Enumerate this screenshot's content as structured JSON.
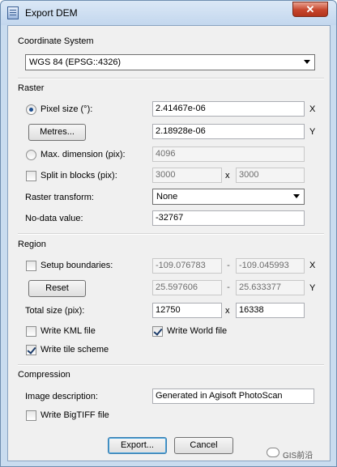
{
  "window": {
    "title": "Export DEM",
    "close_glyph": "✕"
  },
  "coordinate_system": {
    "heading": "Coordinate System",
    "selected": "WGS 84 (EPSG::4326)"
  },
  "raster": {
    "heading": "Raster",
    "pixel_size_label": "Pixel size (°):",
    "pixel_x": "2.41467e-06",
    "pixel_y": "2.18928e-06",
    "metres_button": "Metres...",
    "max_dimension_label": "Max. dimension (pix):",
    "max_dimension_value": "4096",
    "split_blocks_label": "Split in blocks (pix):",
    "block_x": "3000",
    "block_y": "3000",
    "transform_label": "Raster transform:",
    "transform_value": "None",
    "nodata_label": "No-data value:",
    "nodata_value": "-32767"
  },
  "region": {
    "heading": "Region",
    "setup_boundaries_label": "Setup boundaries:",
    "x_min": "-109.076783",
    "x_max": "-109.045993",
    "y_min": "25.597606",
    "y_max": "25.633377",
    "reset_button": "Reset",
    "total_size_label": "Total size (pix):",
    "total_w": "12750",
    "total_h": "16338",
    "write_kml_label": "Write KML file",
    "write_world_label": "Write World file",
    "write_tile_label": "Write tile scheme"
  },
  "compression": {
    "heading": "Compression",
    "image_desc_label": "Image description:",
    "image_desc_value": "Generated in Agisoft PhotoScan",
    "bigtiff_label": "Write BigTIFF file"
  },
  "axes": {
    "x": "X",
    "y": "Y",
    "times": "x",
    "dash": "-"
  },
  "buttons": {
    "export": "Export...",
    "cancel": "Cancel"
  },
  "watermark": {
    "text": "GIS前沿"
  }
}
